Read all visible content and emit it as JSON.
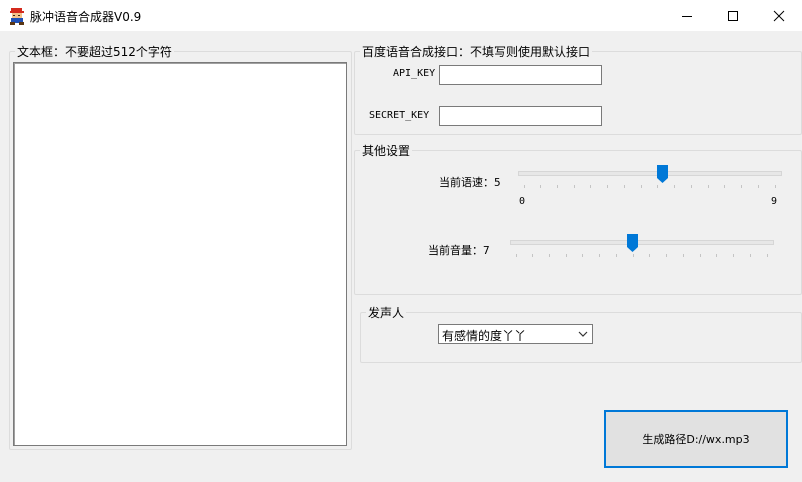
{
  "window": {
    "title": "脉冲语音合成器V0.9",
    "icon": "mario-icon"
  },
  "textbox": {
    "legend": "文本框：不要超过512个字符",
    "value": ""
  },
  "api": {
    "legend": "百度语音合成接口：不填写则使用默认接口",
    "api_key_label": "API_KEY",
    "api_key_value": "",
    "secret_key_label": "SECRET_KEY",
    "secret_key_value": ""
  },
  "settings": {
    "legend": "其他设置",
    "speed_label": "当前语速：5",
    "speed_value": 5,
    "speed_min_label": "0",
    "speed_max_label": "9",
    "volume_label": "当前音量：7",
    "volume_value": 7
  },
  "speaker": {
    "legend": "发声人",
    "selected": "有感情的度丫丫"
  },
  "generate": {
    "label": "生成路径D://wx.mp3"
  },
  "colors": {
    "accent": "#0078d7",
    "window_bg": "#f0f0f0"
  }
}
